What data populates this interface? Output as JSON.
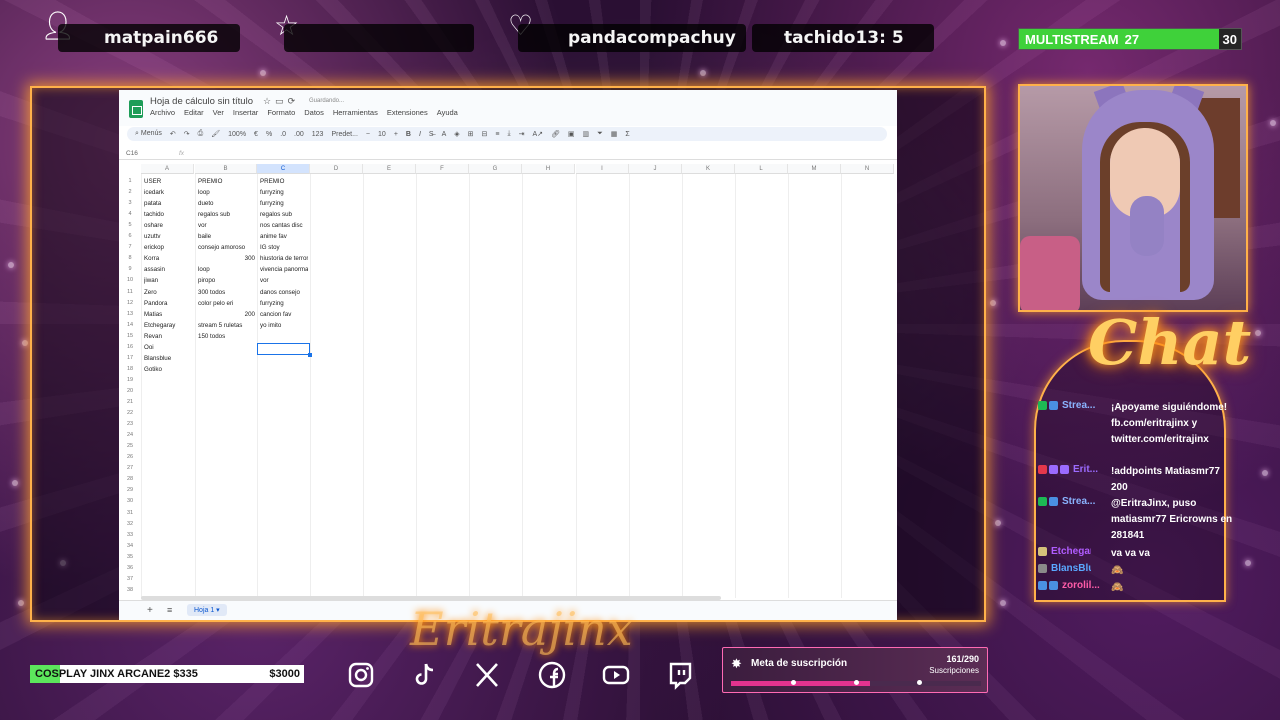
{
  "overlay": {
    "top_users": {
      "follower": "matpain666",
      "star_slot": "",
      "hearts": "pandacompachuy",
      "extra": "tachido13: 5"
    },
    "multistream": {
      "label": "MULTISTREAM",
      "current": "27",
      "goal": "30",
      "progress": 0.9,
      "color": "#3fd13a"
    },
    "chat_title": "Chat",
    "watermark": "Eritrajinx"
  },
  "sheet": {
    "title": "Hoja de cálculo sin título",
    "saving": "Guardando...",
    "menu": [
      "Archivo",
      "Editar",
      "Ver",
      "Insertar",
      "Formato",
      "Datos",
      "Herramientas",
      "Extensiones",
      "Ayuda"
    ],
    "toolbar": {
      "search": "Menús",
      "zoom": "100%",
      "currency": "€",
      "percent": "%",
      "dec_less": ".0",
      "dec_more": ".00",
      "number_fmt": "123",
      "font": "Predet...",
      "font_size": "10",
      "bold": "B",
      "italic": "I"
    },
    "cell_ref": "C16",
    "fx": "fx",
    "columns": [
      "A",
      "B",
      "C",
      "D",
      "E",
      "F",
      "G",
      "H",
      "I",
      "J",
      "K",
      "L",
      "M",
      "N"
    ],
    "active_column": "C",
    "rows": [
      {
        "n": "1",
        "a": "USER",
        "b": "PREMIO",
        "c": "PREMIO"
      },
      {
        "n": "2",
        "a": "icedark",
        "b": "loop",
        "c": "furryzing"
      },
      {
        "n": "3",
        "a": "patata",
        "b": "dueto",
        "c": "furryzing"
      },
      {
        "n": "4",
        "a": "tachido",
        "b": "regalos sub",
        "c": "regalos sub"
      },
      {
        "n": "5",
        "a": "oshare",
        "b": "vor",
        "c": "nos cantas disc"
      },
      {
        "n": "6",
        "a": "uzuttv",
        "b": "baile",
        "c": "anime fav"
      },
      {
        "n": "7",
        "a": "erickop",
        "b": "consejo amoroso",
        "c": "IG stoy"
      },
      {
        "n": "8",
        "a": "Korra",
        "b": "300",
        "c": "hiustoria de terror",
        "b_num": true
      },
      {
        "n": "9",
        "a": "assasin",
        "b": "loop",
        "c": "vivencia panormal"
      },
      {
        "n": "10",
        "a": "jiwan",
        "b": "piropo",
        "c": "vor"
      },
      {
        "n": "11",
        "a": "Zero",
        "b": "300 todos",
        "c": "danos consejo"
      },
      {
        "n": "12",
        "a": "Pandora",
        "b": "color pelo eri",
        "c": "furryzing"
      },
      {
        "n": "13",
        "a": "Matias",
        "b": "200",
        "c": "cancion fav",
        "b_num": true
      },
      {
        "n": "14",
        "a": "Etchegaray",
        "b": "stream 5 ruletas",
        "c": "yo imito"
      },
      {
        "n": "15",
        "a": "Revan",
        "b": "150 todos",
        "c": ""
      },
      {
        "n": "16",
        "a": "Ooi",
        "b": "",
        "c": ""
      },
      {
        "n": "17",
        "a": "Blansblue",
        "b": "",
        "c": ""
      },
      {
        "n": "18",
        "a": "Gotiko",
        "b": "",
        "c": ""
      },
      {
        "n": "19",
        "a": "",
        "b": "",
        "c": ""
      },
      {
        "n": "20",
        "a": "",
        "b": "",
        "c": ""
      },
      {
        "n": "21",
        "a": "",
        "b": "",
        "c": ""
      },
      {
        "n": "22",
        "a": "",
        "b": "",
        "c": ""
      },
      {
        "n": "23",
        "a": "",
        "b": "",
        "c": ""
      },
      {
        "n": "24",
        "a": "",
        "b": "",
        "c": ""
      },
      {
        "n": "25",
        "a": "",
        "b": "",
        "c": ""
      },
      {
        "n": "26",
        "a": "",
        "b": "",
        "c": ""
      },
      {
        "n": "27",
        "a": "",
        "b": "",
        "c": ""
      },
      {
        "n": "28",
        "a": "",
        "b": "",
        "c": ""
      },
      {
        "n": "29",
        "a": "",
        "b": "",
        "c": ""
      },
      {
        "n": "30",
        "a": "",
        "b": "",
        "c": ""
      },
      {
        "n": "31",
        "a": "",
        "b": "",
        "c": ""
      },
      {
        "n": "32",
        "a": "",
        "b": "",
        "c": ""
      },
      {
        "n": "33",
        "a": "",
        "b": "",
        "c": ""
      },
      {
        "n": "34",
        "a": "",
        "b": "",
        "c": ""
      },
      {
        "n": "35",
        "a": "",
        "b": "",
        "c": ""
      },
      {
        "n": "36",
        "a": "",
        "b": "",
        "c": ""
      },
      {
        "n": "37",
        "a": "",
        "b": "",
        "c": ""
      },
      {
        "n": "38",
        "a": "",
        "b": "",
        "c": ""
      }
    ],
    "selected_row": "16",
    "footer": {
      "add": "+",
      "list": "≡",
      "tab": "Hoja 1"
    }
  },
  "chat": {
    "messages": [
      {
        "user": "Strea...",
        "user_color": "#8ab4ff",
        "badges": [
          "#1db954",
          "#4a90e2"
        ],
        "text": "¡Apoyame siguiéndome! fb.com/eritrajinx y twitter.com/eritrajinx"
      },
      {
        "user": "Erit...",
        "user_color": "#9b6bff",
        "badges": [
          "#e5384b",
          "#9b6bff",
          "#9b6bff"
        ],
        "text": "!addpoints Matiasmr77 200"
      },
      {
        "user": "Strea...",
        "user_color": "#8ab4ff",
        "badges": [
          "#1db954",
          "#4a90e2"
        ],
        "text": "@EritraJinx, puso matiasmr77 Ericrowns en 281841"
      },
      {
        "user": "Etchegar...",
        "user_color": "#b05cff",
        "badges": [
          "#d4c27a"
        ],
        "text": "va va va"
      },
      {
        "user": "BlansBlue",
        "user_color": "#5aa8ff",
        "badges": [
          "#8a8a8a"
        ],
        "text": "🙈"
      },
      {
        "user": "zorolil...",
        "user_color": "#ff5ca8",
        "badges": [
          "#4a90e2",
          "#4a90e2"
        ],
        "text": "🙈"
      }
    ]
  },
  "bottom": {
    "donation": {
      "label": "COSPLAY JINX ARCANE2 $335",
      "goal": "$3000",
      "progress": 0.11,
      "color": "#5ce65c"
    },
    "social": [
      "instagram-icon",
      "tiktok-icon",
      "x-icon",
      "facebook-icon",
      "youtube-icon",
      "twitch-icon"
    ],
    "subs": {
      "title": "Meta de suscripción",
      "count": "161/290",
      "label": "Suscripciones",
      "progress": 0.555,
      "color": "#e3338f"
    }
  }
}
